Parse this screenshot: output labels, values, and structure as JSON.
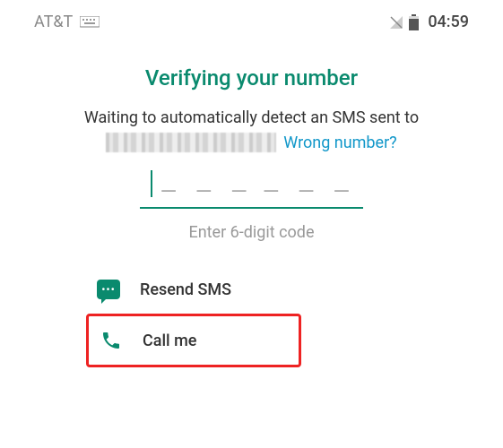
{
  "status_bar": {
    "carrier": "AT&T",
    "time": "04:59"
  },
  "header": {
    "title": "Verifying your number"
  },
  "waiting": {
    "text": "Waiting to automatically detect an SMS sent to",
    "wrong_number_link": "Wrong number?"
  },
  "code_input": {
    "placeholder_group1": "– – –",
    "placeholder_group2": "– – –",
    "hint": "Enter 6-digit code"
  },
  "actions": {
    "resend_label": "Resend SMS",
    "callme_label": "Call me"
  },
  "colors": {
    "accent": "#0a8a6e",
    "link": "#1197c9",
    "highlight_border": "#e22"
  }
}
